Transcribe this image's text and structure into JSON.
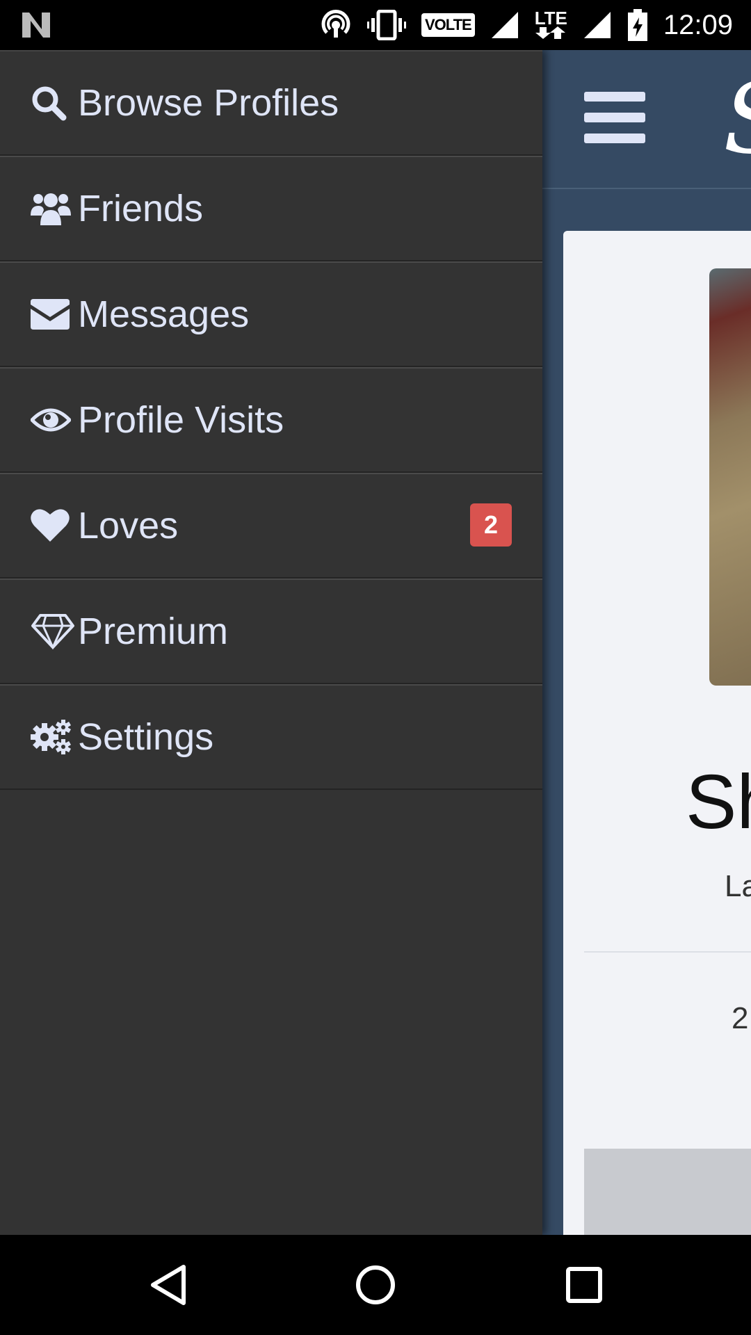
{
  "status_bar": {
    "time": "12:09",
    "volte_label": "VOLTE",
    "lte_label": "LTE"
  },
  "drawer": {
    "items": [
      {
        "label": "Browse Profiles",
        "icon": "search-icon"
      },
      {
        "label": "Friends",
        "icon": "users-icon"
      },
      {
        "label": "Messages",
        "icon": "envelope-icon"
      },
      {
        "label": "Profile Visits",
        "icon": "eye-icon"
      },
      {
        "label": "Loves",
        "icon": "heart-icon",
        "badge": "2"
      },
      {
        "label": "Premium",
        "icon": "diamond-icon"
      },
      {
        "label": "Settings",
        "icon": "gears-icon"
      }
    ]
  },
  "main": {
    "logo_letter": "S",
    "name_partial": "Sh",
    "subtitle_partial": "La",
    "stat_partial": "2"
  },
  "colors": {
    "drawer_bg": "#333333",
    "drawer_text": "#dfe5f7",
    "main_bg": "#354a63",
    "card_bg": "#f2f3f7",
    "badge": "#d9534f"
  }
}
